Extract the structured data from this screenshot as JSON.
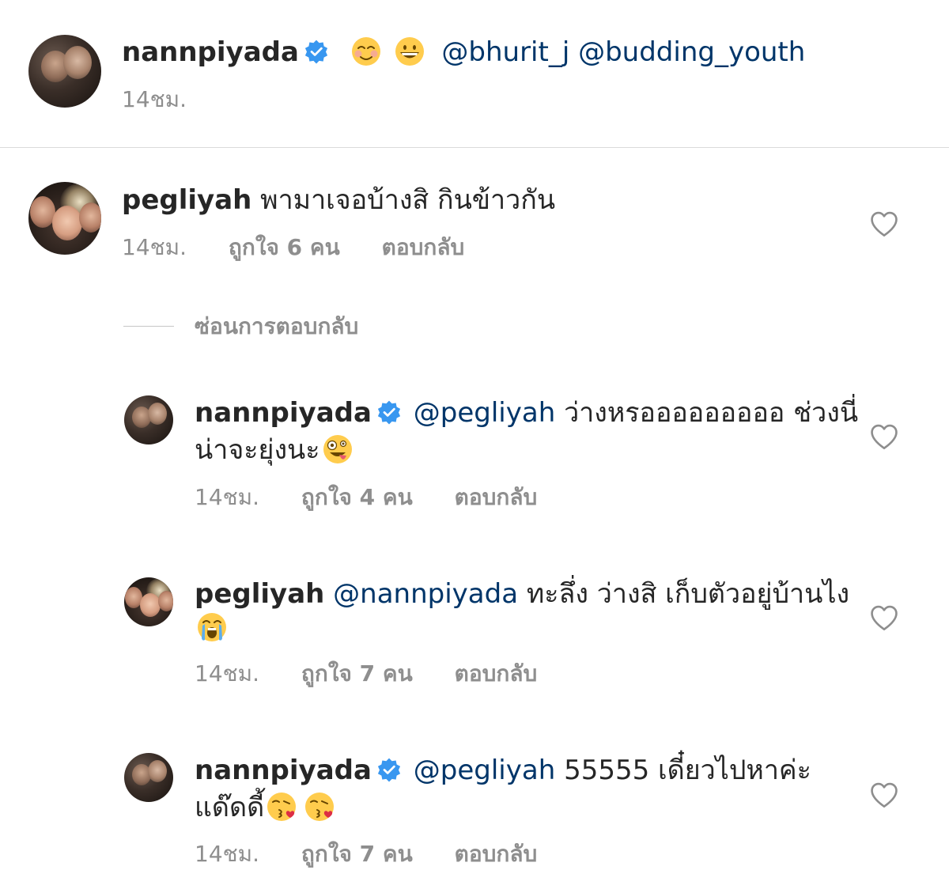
{
  "post_caption": {
    "username": "nannpiyada",
    "verified": true,
    "emojis": [
      "smiling-face-with-blush-icon",
      "grinning-face-icon"
    ],
    "mentions": "@bhurit_j @budding_youth",
    "time": "14ชม."
  },
  "comment": {
    "username": "pegliyah",
    "text": "พามาเจอบ้างสิ กินข้าวกัน",
    "time": "14ชม.",
    "likes": "ถูกใจ 6 คน",
    "reply_label": "ตอบกลับ"
  },
  "hide_replies_label": "ซ่อนการตอบกลับ",
  "replies": [
    {
      "username": "nannpiyada",
      "verified": true,
      "mention": "@pegliyah",
      "text_line1": "ว่างหรอออออออออ ช่วงนี่",
      "text_line2": "น่าจะยุ่งนะ",
      "emoji": "zany-face-icon",
      "time": "14ชม.",
      "likes": "ถูกใจ 4 คน",
      "reply_label": "ตอบกลับ"
    },
    {
      "username": "pegliyah",
      "verified": false,
      "mention": "@nannpiyada",
      "text_line1": "ทะลึ่ง ว่างสิ เก็บตัวอยู่บ้านไง",
      "text_line2": "",
      "emoji": "loudly-crying-face-icon",
      "time": "14ชม.",
      "likes": "ถูกใจ 7 คน",
      "reply_label": "ตอบกลับ"
    },
    {
      "username": "nannpiyada",
      "verified": true,
      "mention": "@pegliyah",
      "text_line1": "55555 เดี๋ยวไปหาค่ะ",
      "text_line2": "แด๊ดดี้",
      "emoji": "face-blowing-kiss-icon",
      "time": "14ชม.",
      "likes": "ถูกใจ 7 คน",
      "reply_label": "ตอบกลับ"
    }
  ],
  "colors": {
    "username": "#262626",
    "mention": "#003569",
    "meta": "#8e8e8e",
    "verified": "#3897f0",
    "divider": "#dbdbdb"
  }
}
